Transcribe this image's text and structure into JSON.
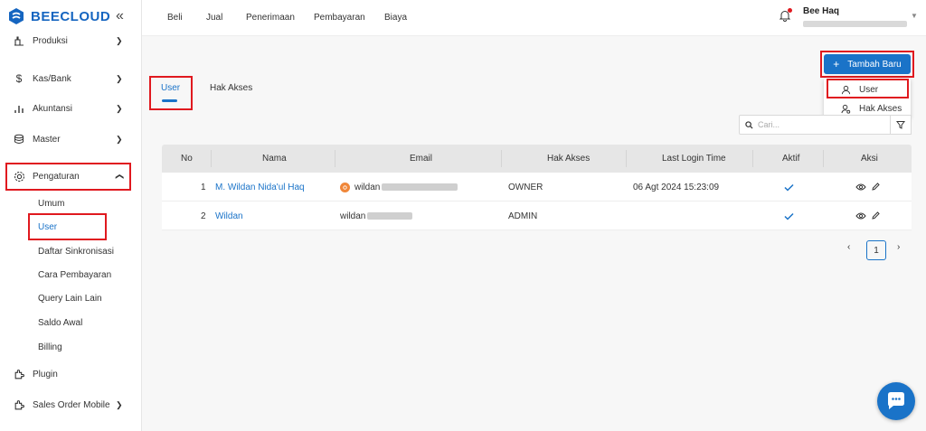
{
  "brand": {
    "name": "BEECLOUD"
  },
  "sidebar": {
    "items": [
      {
        "label": "Produksi"
      },
      {
        "label": "Kas/Bank"
      },
      {
        "label": "Akuntansi"
      },
      {
        "label": "Master"
      },
      {
        "label": "Pengaturan"
      },
      {
        "label": "Plugin"
      },
      {
        "label": "Sales Order Mobile"
      }
    ],
    "sub_items": [
      {
        "label": "Umum"
      },
      {
        "label": "User"
      },
      {
        "label": "Daftar Sinkronisasi"
      },
      {
        "label": "Cara Pembayaran"
      },
      {
        "label": "Query Lain Lain"
      },
      {
        "label": "Saldo Awal"
      },
      {
        "label": "Billing"
      }
    ]
  },
  "topnav": {
    "items": [
      "Beli",
      "Jual",
      "Penerimaan",
      "Pembayaran",
      "Biaya"
    ]
  },
  "user": {
    "name": "Bee Haq"
  },
  "tabs": {
    "user": "User",
    "hak_akses": "Hak Akses"
  },
  "add_button": {
    "label": "Tambah Baru"
  },
  "dropdown": {
    "user": "User",
    "hak_akses": "Hak Akses"
  },
  "search": {
    "placeholder": "Cari..."
  },
  "table": {
    "headers": {
      "no": "No",
      "nama": "Nama",
      "email": "Email",
      "hak_akses": "Hak Akses",
      "last_login": "Last Login Time",
      "aktif": "Aktif",
      "aksi": "Aksi"
    },
    "rows": [
      {
        "no": "1",
        "nama": "M. Wildan Nida'ul Haq",
        "email": "wildan",
        "hak_akses": "OWNER",
        "last_login": "06 Agt 2024 15:23:09"
      },
      {
        "no": "2",
        "nama": "Wildan",
        "email": "wildan",
        "hak_akses": "ADMIN",
        "last_login": ""
      }
    ]
  },
  "pagination": {
    "current": "1"
  },
  "colors": {
    "primary": "#1a73c8",
    "highlight": "#e0191f"
  }
}
